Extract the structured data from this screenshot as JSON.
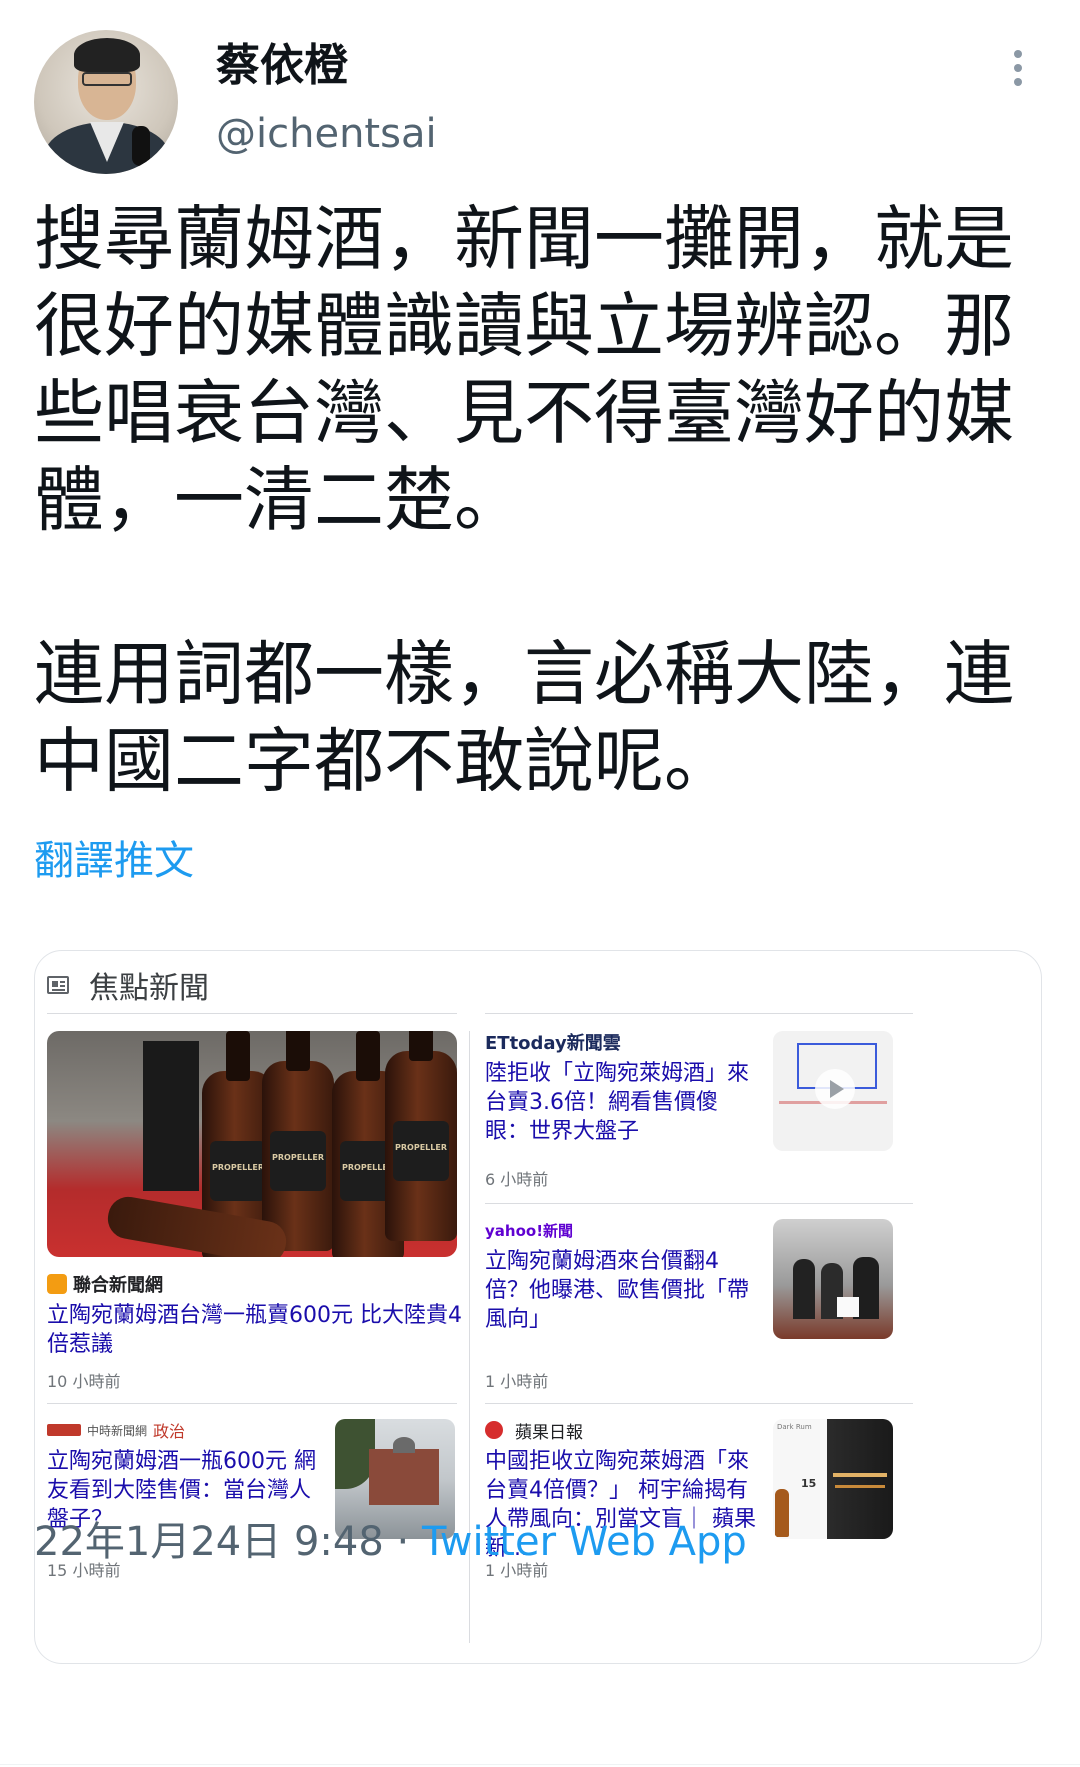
{
  "user": {
    "display_name": "蔡依橙",
    "handle": "@ichentsai"
  },
  "tweet": {
    "text": "搜尋蘭姆酒，新聞一攤開，就是很好的媒體識讀與立場辨認。那些唱衰台灣、見不得臺灣好的媒體，一清二楚。\n\n連用詞都一樣，言必稱大陸，連中國二字都不敢說呢。",
    "translate_label": "翻譯推文",
    "date": "22年1月24日 9:48",
    "separator": "·",
    "app": "Twitter Web App"
  },
  "news_card": {
    "title": "焦點新聞",
    "items": [
      {
        "source": "聯合新聞網",
        "headline": "立陶宛蘭姆酒台灣一瓶賣600元 比大陸貴4倍惹議",
        "time": "10 小時前",
        "image_text": "PROPELLER"
      },
      {
        "source": "ETtoday新聞雲",
        "headline": "陸拒收「立陶宛萊姆酒」來台賣3.6倍！網看售價傻眼：世界大盤子",
        "time": "6 小時前"
      },
      {
        "source": "yahoo!新聞",
        "headline": "立陶宛蘭姆酒來台價翻4倍？他曝港、歐售價批「帶風向」",
        "time": "1 小時前"
      },
      {
        "source": "中時新聞網",
        "source_tag": "政治",
        "headline": "立陶宛蘭姆酒一瓶600元 網友看到大陸售價：當台灣人盤子？",
        "time": "15 小時前"
      },
      {
        "source": "蘋果日報",
        "headline": "中國拒收立陶宛萊姆酒「來台賣4倍價？」 柯宇綸揭有人帶風向：別當文盲｜ 蘋果新...",
        "time": "1 小時前",
        "image_text_1": "Dark Rum",
        "image_text_2": "15"
      }
    ]
  },
  "colors": {
    "link_blue": "#1d9bf0",
    "news_link": "#1a0dab",
    "secondary_text": "#536471"
  },
  "icons": [
    "more-vert-icon",
    "news-icon",
    "play-icon",
    "apple-icon"
  ]
}
